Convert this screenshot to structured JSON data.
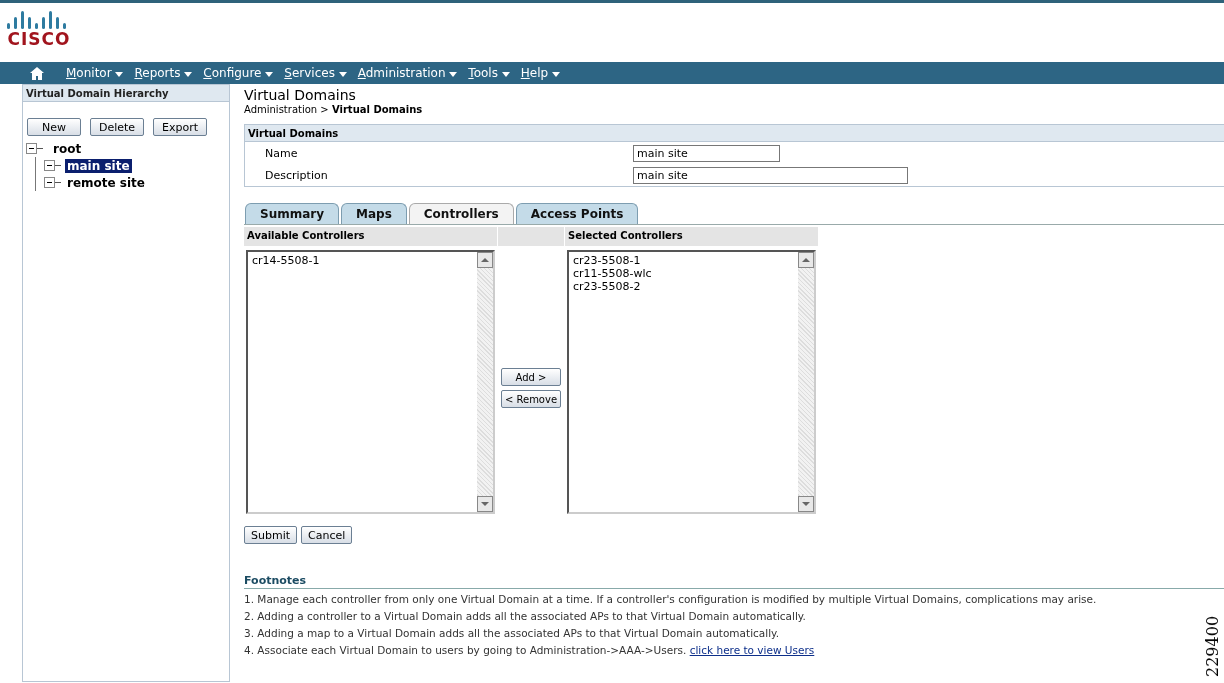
{
  "logo": {
    "text": "CISCO"
  },
  "nav": [
    {
      "label": "Monitor"
    },
    {
      "label": "Reports"
    },
    {
      "label": "Configure"
    },
    {
      "label": "Services"
    },
    {
      "label": "Administration"
    },
    {
      "label": "Tools"
    },
    {
      "label": "Help"
    }
  ],
  "sidebar": {
    "title": "Virtual Domain Hierarchy",
    "buttons": [
      "New",
      "Delete",
      "Export"
    ],
    "tree": [
      {
        "label": "root",
        "expanded": true,
        "selected": false,
        "children": [
          {
            "label": "main site",
            "expanded": true,
            "selected": true
          },
          {
            "label": "remote site",
            "expanded": true,
            "selected": false
          }
        ]
      }
    ]
  },
  "page": {
    "title": "Virtual Domains",
    "breadcrumb": [
      "Administration",
      ">",
      "Virtual Domains"
    ]
  },
  "form": {
    "title": "Virtual Domains",
    "fields": [
      {
        "label": "Name",
        "value": "main site",
        "kind": "short"
      },
      {
        "label": "Description",
        "value": "main site",
        "kind": "long"
      }
    ]
  },
  "tabs": [
    {
      "label": "Summary",
      "selected": false
    },
    {
      "label": "Maps",
      "selected": false
    },
    {
      "label": "Controllers",
      "selected": true
    },
    {
      "label": "Access Points",
      "selected": false
    }
  ],
  "available": {
    "title": "Available Controllers",
    "items": [
      "cr14-5508-1"
    ]
  },
  "selected_list": {
    "title": "Selected Controllers",
    "items": [
      "cr23-5508-1",
      "cr11-5508-wlc",
      "cr23-5508-2"
    ]
  },
  "move_buttons": [
    "Add >",
    "< Remove"
  ],
  "actions": [
    "Submit",
    "Cancel"
  ],
  "footnotes": {
    "title": "Footnotes",
    "items": [
      {
        "text": "1. Manage each controller from only one Virtual Domain at a time. If a controller's configuration is modified by multiple Virtual Domains, complications may arise."
      },
      {
        "text": "2. Adding a controller to a Virtual Domain adds all the associated APs to that Virtual Domain automatically."
      },
      {
        "text": "3. Adding a map to a Virtual Domain adds all the associated APs to that Virtual Domain automatically."
      },
      {
        "text": "4. Associate each Virtual Domain to users by going to Administration->AAA->Users.",
        "link": "click here to view Users"
      }
    ]
  },
  "figure_number": "229400"
}
